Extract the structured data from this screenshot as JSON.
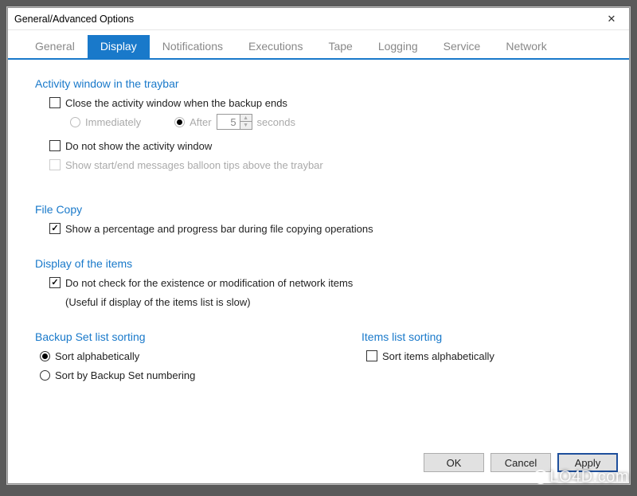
{
  "window": {
    "title": "General/Advanced Options",
    "close_label": "✕"
  },
  "tabs": [
    {
      "label": "General"
    },
    {
      "label": "Display"
    },
    {
      "label": "Notifications"
    },
    {
      "label": "Executions"
    },
    {
      "label": "Tape"
    },
    {
      "label": "Logging"
    },
    {
      "label": "Service"
    },
    {
      "label": "Network"
    }
  ],
  "activeTab": 1,
  "sections": {
    "activity": {
      "title": "Activity window in the traybar",
      "close_when_ends": {
        "label": "Close the activity window when the backup ends",
        "checked": false
      },
      "immediately": {
        "label": "Immediately",
        "selected": false
      },
      "after": {
        "label": "After",
        "selected": true
      },
      "seconds_value": "5",
      "seconds_suffix": "seconds",
      "do_not_show": {
        "label": "Do not show the activity window",
        "checked": false
      },
      "balloon_tips": {
        "label": "Show start/end messages balloon tips above the traybar",
        "checked": false
      }
    },
    "filecopy": {
      "title": "File Copy",
      "progress": {
        "label": "Show a percentage and progress bar during file copying operations",
        "checked": true
      }
    },
    "display_items": {
      "title": "Display of the items",
      "no_check_network": {
        "label": "Do not check for the existence or modification of network items",
        "checked": true
      },
      "note": "(Useful if display of the items list is slow)"
    },
    "backup_sort": {
      "title": "Backup Set list sorting",
      "alpha": {
        "label": "Sort alphabetically",
        "selected": true
      },
      "numbering": {
        "label": "Sort by Backup Set numbering",
        "selected": false
      }
    },
    "items_sort": {
      "title": "Items list sorting",
      "alpha": {
        "label": "Sort items alphabetically",
        "checked": false
      }
    }
  },
  "buttons": {
    "ok": "OK",
    "cancel": "Cancel",
    "apply": "Apply"
  },
  "watermark": "LO4D.com"
}
